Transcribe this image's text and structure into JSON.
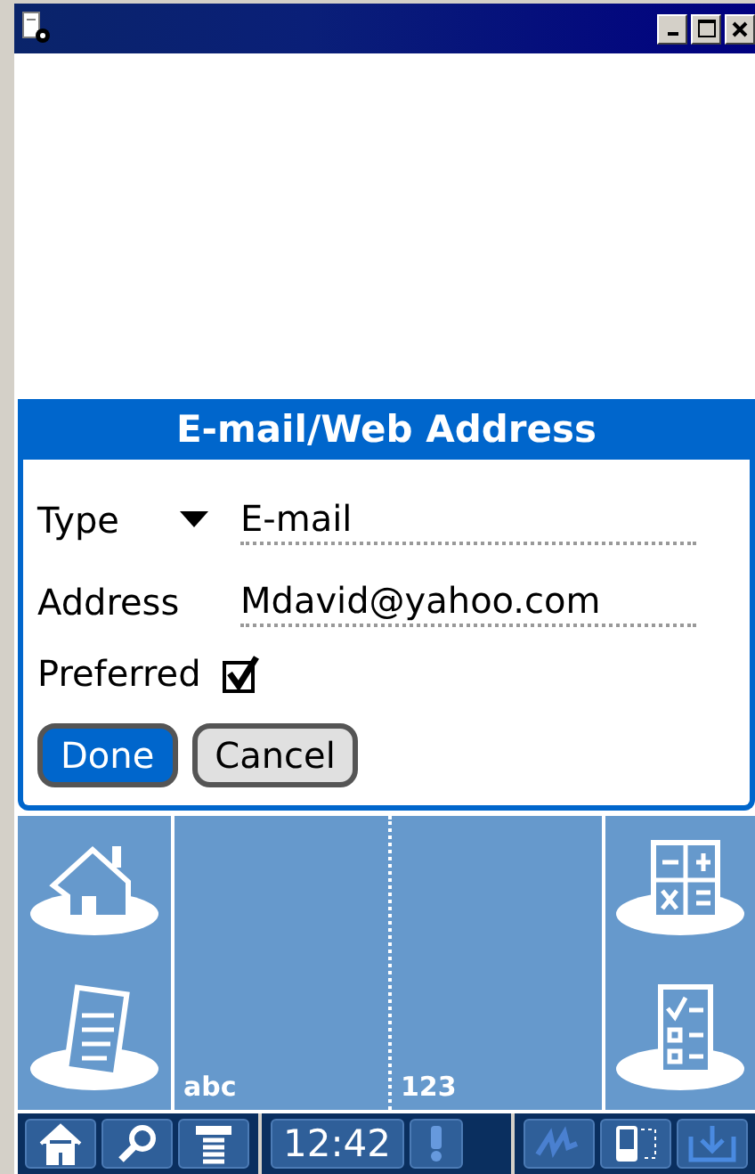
{
  "dialog": {
    "title": "E-mail/Web Address",
    "fields": [
      {
        "kind": "dropdown",
        "label": "Type",
        "value": "E-mail"
      },
      {
        "kind": "text",
        "label": "Address",
        "value": "Mdavid@yahoo.com"
      },
      {
        "kind": "checkbox",
        "label": "Preferred",
        "checked": true
      }
    ],
    "buttons": [
      {
        "label": "Done",
        "selected": true
      },
      {
        "label": "Cancel",
        "selected": false
      }
    ]
  },
  "input_area": {
    "letters_label": "abc",
    "numbers_label": "123"
  },
  "status_bar": {
    "time": "12:42"
  }
}
